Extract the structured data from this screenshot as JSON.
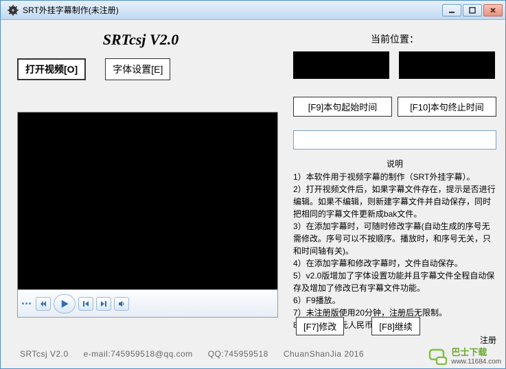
{
  "window": {
    "title": "SRT外挂字幕制作(未注册)"
  },
  "app_title": "SRTcsj V2.0",
  "buttons": {
    "open_video": "打开视频[O]",
    "font_setting": "字体设置[E]"
  },
  "right": {
    "position_label": "当前位置：",
    "f9_btn": "[F9]本句起始时间",
    "f10_btn": "[F10]本句终止时间"
  },
  "desc": {
    "title": "说明",
    "lines": [
      "1）本软件用于视频字幕的制作（SRT外挂字幕）。",
      "2）打开视频文件后，如果字幕文件存在，提示是否进行编辑。如果不编辑，则新建字幕文件并自动保存，同时把相同的字幕文件更新成bak文件。",
      "3）在添加字幕时，可随时修改字幕(自动生成的序号无需修改。序号可以不按顺序。播放时，和序号无关，只和时间轴有关)。",
      "4）在添加字幕和修改字幕时，文件自动保存。",
      "5）v2.0版增加了字体设置功能并且字幕文件全程自动保存及增加了修改已有字幕文件功能。",
      "6）F9播放。",
      "7）未注册版使用20分钟，注册后无限制。",
      "8）本软件20元人民币。"
    ],
    "register": "注册"
  },
  "footer_buttons": {
    "f7": "[F7]修改",
    "f8": "[F8]继续"
  },
  "footer_info": {
    "version": "SRTcsj V2.0",
    "email": "e-mail:745959518@qq.com",
    "qq": "QQ:745959518",
    "author": "ChuanShanJia 2016"
  },
  "watermark": {
    "site": "www.11684.com",
    "label": "巴士下载"
  }
}
